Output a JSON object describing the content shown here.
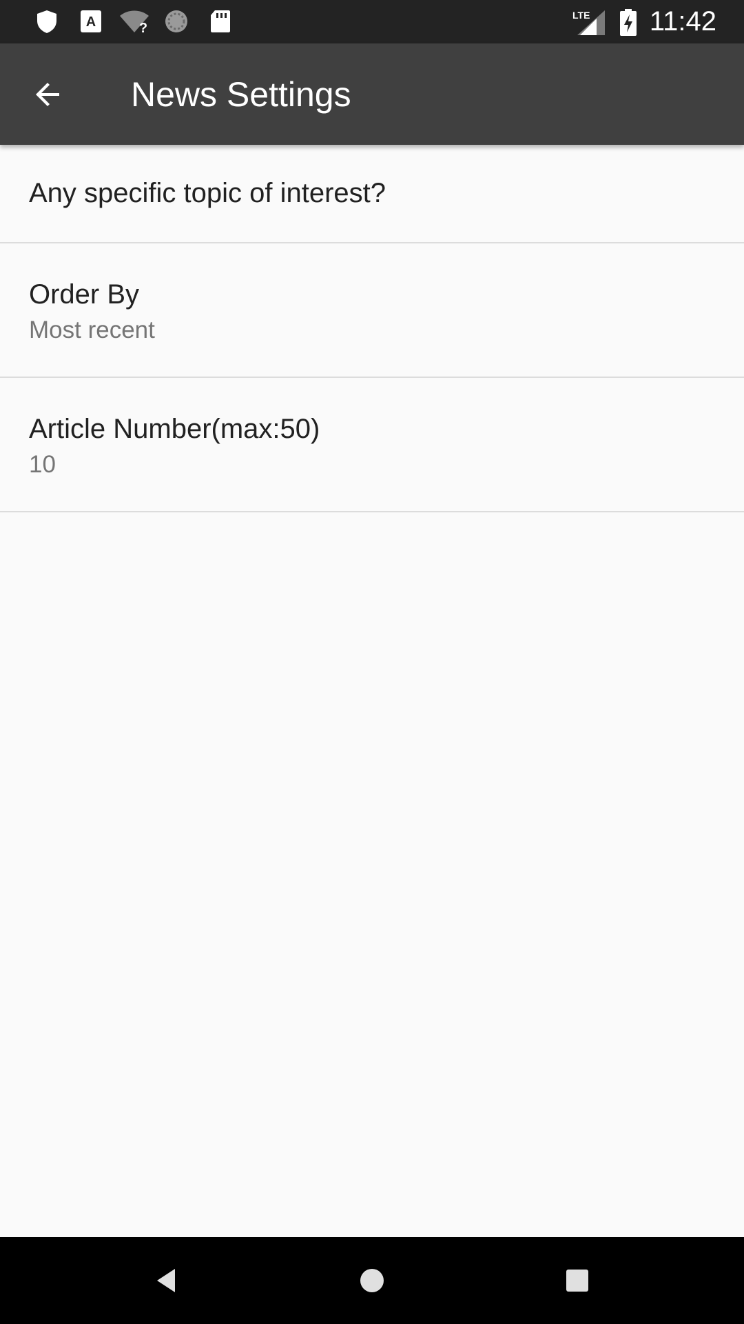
{
  "status_bar": {
    "time": "11:42",
    "network_label": "LTE",
    "icons": [
      "shield-icon",
      "keyboard-a-icon",
      "wifi-unknown-icon",
      "sync-spinner-icon",
      "sd-card-icon",
      "signal-icon",
      "battery-charging-icon"
    ]
  },
  "app_bar": {
    "title": "News Settings",
    "back_icon": "arrow-left-icon"
  },
  "preferences": [
    {
      "title": "Any specific topic of interest?"
    },
    {
      "title": "Order By",
      "summary": "Most recent"
    },
    {
      "title": "Article Number(max:50)",
      "summary": "10"
    }
  ],
  "nav_bar": {
    "icons": [
      "back-triangle-icon",
      "home-circle-icon",
      "recents-square-icon"
    ]
  },
  "colors": {
    "status_bar": "#232323",
    "app_bar": "#404040",
    "background": "#fafafa",
    "title_text": "#212121",
    "summary_text": "#757575",
    "divider": "#dcdcdc",
    "nav_bar": "#000000"
  }
}
